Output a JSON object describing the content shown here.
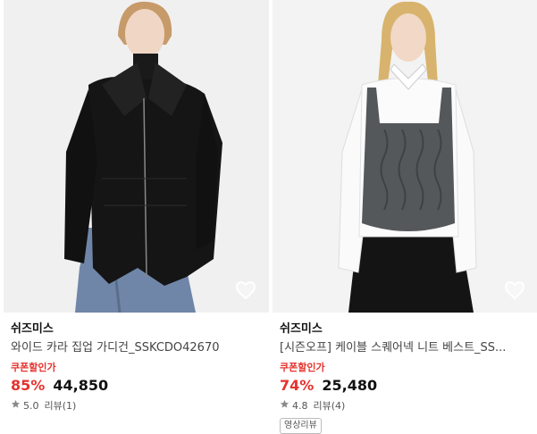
{
  "products": [
    {
      "brand": "쉬즈미스",
      "name": "와이드 카라 집업 가디건_SSKCDO42670",
      "coupon_label": "쿠폰할인가",
      "discount": "85%",
      "price": "44,850",
      "rating": "5.0",
      "review": "리뷰(1)",
      "wishlist_icon": "heart-outline-icon",
      "photo": "model in black zip-up cardigan and jeans"
    },
    {
      "brand": "쉬즈미스",
      "name": "[시즌오프] 케이블 스퀘어넥 니트 베스트_SS...",
      "coupon_label": "쿠폰할인가",
      "discount": "74%",
      "price": "25,480",
      "rating": "4.8",
      "review": "리뷰(4)",
      "badge": "영상리뷰",
      "wishlist_icon": "heart-outline-icon",
      "photo": "model in grey cable knit vest over white shirt"
    }
  ],
  "colors": {
    "accent": "#e5322d",
    "star": "#8a8a8a"
  }
}
